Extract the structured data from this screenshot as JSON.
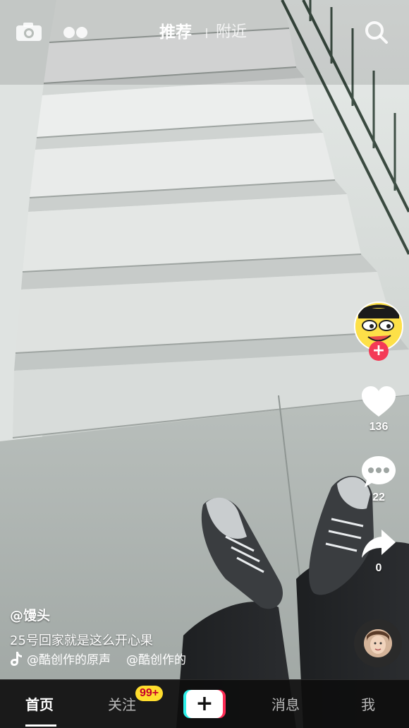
{
  "top_tabs": {
    "recommend": "推荐",
    "nearby": "附近"
  },
  "icons": {
    "camera": "camera-icon",
    "duo": "duo-camera-icon",
    "search": "search-icon",
    "like": "heart-icon",
    "comment": "comment-bubble-icon",
    "share": "share-arrow-icon",
    "music_note": "music-note-icon"
  },
  "side_actions": {
    "follow_plus": "+",
    "likes": "136",
    "comments": "22",
    "shares": "0"
  },
  "post": {
    "author": "@馒头",
    "description": "25号回家就是这么开心果",
    "music_1": "@酷创作的原声",
    "music_2": "@酷创作的"
  },
  "bottom_nav": {
    "home": "首页",
    "follow": "关注",
    "badge": "99+",
    "create": "+",
    "messages": "消息",
    "me": "我"
  },
  "colors": {
    "accent_red": "#fe2c55",
    "accent_cyan": "#2ef0ea",
    "badge_yellow": "#ffdd2e",
    "follow_plus": "#f43a56"
  }
}
